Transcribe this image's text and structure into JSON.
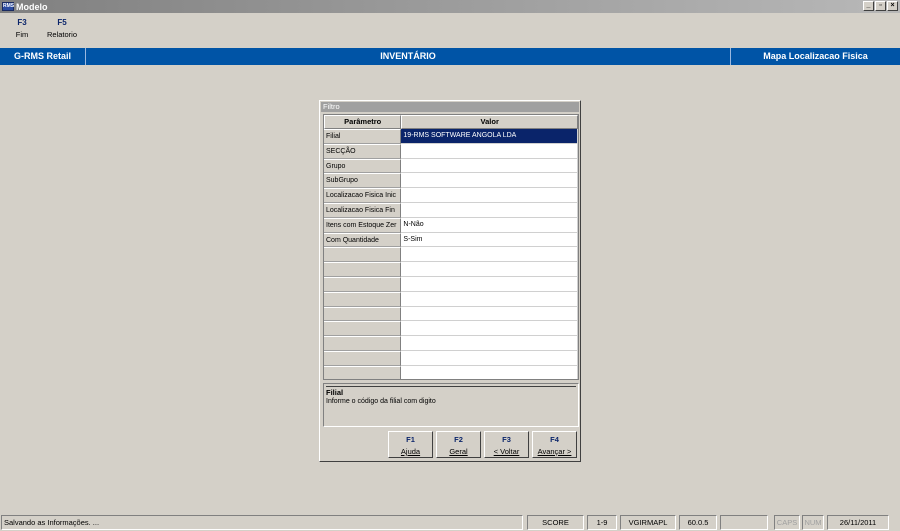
{
  "window": {
    "title": "Modelo",
    "icon_text": "RMS"
  },
  "toolbar": [
    {
      "key": "F3",
      "label": "Fim"
    },
    {
      "key": "F5",
      "label": "Relatorio"
    }
  ],
  "header": {
    "left": "G-RMS Retail",
    "center": "INVENTÁRIO",
    "right": "Mapa Localizacao Fisica"
  },
  "dialog": {
    "title": "Filtro",
    "columns": [
      "Parâmetro",
      "Valor"
    ],
    "rows": [
      {
        "param": "Filial",
        "value": "19-RMS SOFTWARE ANGOLA LDA"
      },
      {
        "param": "SECÇÃO",
        "value": ""
      },
      {
        "param": "Grupo",
        "value": ""
      },
      {
        "param": "SubGrupo",
        "value": ""
      },
      {
        "param": "Localizacao Fisica Inic",
        "value": ""
      },
      {
        "param": "Localizacao Fisica Fin",
        "value": ""
      },
      {
        "param": "Itens com Estoque Zer",
        "value": "N-Não"
      },
      {
        "param": "Com Quantidade",
        "value": "S-Sim"
      },
      {
        "param": "",
        "value": ""
      },
      {
        "param": "",
        "value": ""
      },
      {
        "param": "",
        "value": ""
      },
      {
        "param": "",
        "value": ""
      },
      {
        "param": "",
        "value": ""
      },
      {
        "param": "",
        "value": ""
      },
      {
        "param": "",
        "value": ""
      },
      {
        "param": "",
        "value": ""
      },
      {
        "param": "",
        "value": ""
      }
    ],
    "help_title": "Filial",
    "help_text": "Informe o código da filial com digito",
    "buttons": [
      {
        "key": "F1",
        "label": "Ajuda"
      },
      {
        "key": "F2",
        "label": "Geral"
      },
      {
        "key": "F3",
        "label": "< Voltar"
      },
      {
        "key": "F4",
        "label": "Avançar >"
      }
    ]
  },
  "statusbar": {
    "message": "Salvando as Informações. ...",
    "db": "SCORE",
    "range": "1-9",
    "program": "VGIRMAPL",
    "version": "60.0.5",
    "blank": "",
    "caps": "CAPS",
    "num": "NUM",
    "date": "26/11/2011"
  }
}
